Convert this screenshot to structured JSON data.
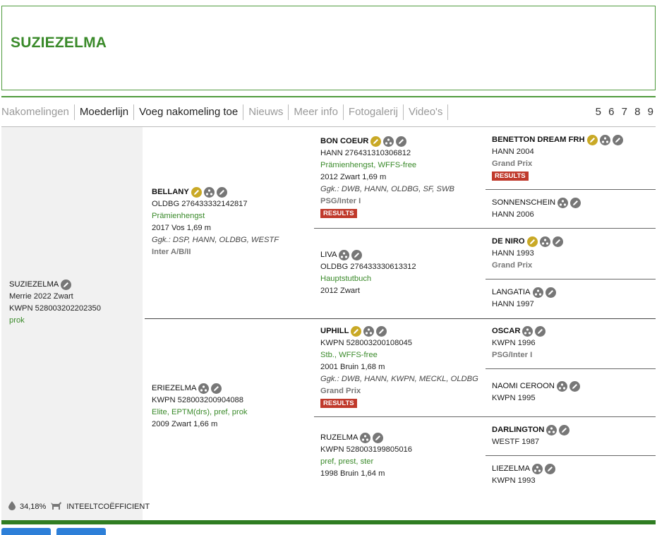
{
  "page": {
    "title": "SUZIEZELMA"
  },
  "nav": {
    "items": [
      {
        "label": "Nakomelingen",
        "style": "dim"
      },
      {
        "label": "Moederlijn",
        "style": "dark"
      },
      {
        "label": "Voeg nakomeling toe",
        "style": "dark"
      },
      {
        "label": "Nieuws",
        "style": "dim"
      },
      {
        "label": "Meer info",
        "style": "dim"
      },
      {
        "label": "Fotogalerij",
        "style": "dim"
      },
      {
        "label": "Video's",
        "style": "dim"
      }
    ],
    "pages": "5 6 7 8 9"
  },
  "subject": {
    "name": "SUZIEZELMA",
    "line1": "Merrie 2022 Zwart",
    "line2": "KWPN 528003202202350",
    "line3": "prok"
  },
  "sire": {
    "name": "BELLANY",
    "reg": "OLDBG 276433332142817",
    "pred": "Prämienhengst",
    "info": "2017 Vos 1,69 m",
    "ggk": "Ggk.: DSP, HANN, OLDBG, WESTF",
    "level": "Inter A/B/II"
  },
  "dam": {
    "name": "ERIEZELMA",
    "reg": "KWPN 528003200904088",
    "pred": "Elite, EPTM(drs), pref, prok",
    "info": "2009 Zwart 1,66 m"
  },
  "ss": {
    "name": "BON COEUR",
    "reg": "HANN 276431310306812",
    "pred": "Prämienhengst, WFFS-free",
    "info": "2012 Zwart 1,69 m",
    "ggk": "Ggk.: DWB, HANN, OLDBG, SF, SWB",
    "level": "PSG/Inter I",
    "results": "RESULTS"
  },
  "sd": {
    "name": "LIVA",
    "reg": "OLDBG 276433330613312",
    "pred": "Hauptstutbuch",
    "info": "2012 Zwart"
  },
  "ds": {
    "name": "UPHILL",
    "reg": "KWPN 528003200108045",
    "pred": "Stb., WFFS-free",
    "info": "2001 Bruin 1,68 m",
    "ggk": "Ggk.: DWB, HANN, KWPN, MECKL, OLDBG",
    "level": "Grand Prix",
    "results": "RESULTS"
  },
  "dd": {
    "name": "RUZELMA",
    "reg": "KWPN 528003199805016",
    "pred": "pref, prest, ster",
    "info": "1998 Bruin 1,64 m"
  },
  "g1": {
    "name": "BENETTON DREAM FRH",
    "reg": "HANN 2004",
    "level": "Grand Prix",
    "results": "RESULTS"
  },
  "g2": {
    "name": "SONNENSCHEIN",
    "reg": "HANN 2006"
  },
  "g3": {
    "name": "DE NIRO",
    "reg": "HANN 1993",
    "level": "Grand Prix"
  },
  "g4": {
    "name": "LANGATIA",
    "reg": "HANN 1997"
  },
  "g5": {
    "name": "OSCAR",
    "reg": "KWPN 1996",
    "level": "PSG/Inter I"
  },
  "g6": {
    "name": "NAOMI CEROON",
    "reg": "KWPN 1995"
  },
  "g7": {
    "name": "DARLINGTON",
    "reg": "WESTF 1987"
  },
  "g8": {
    "name": "LIEZELMA",
    "reg": "KWPN 1993"
  },
  "footer": {
    "percent": "34,18%",
    "label": "INTEELTCOËFFICIENT"
  },
  "colors": {
    "accent": "#3a8a2a",
    "border": "#4f9a3c",
    "results": "#c0392b",
    "gold_icon": "#c9a926"
  }
}
